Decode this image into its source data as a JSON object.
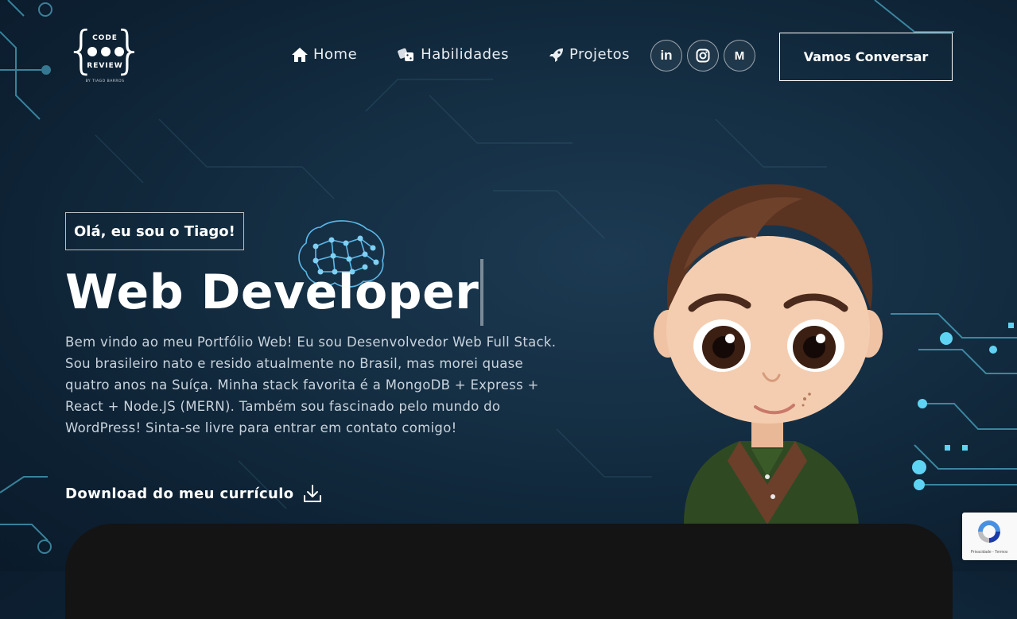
{
  "header": {
    "logo": {
      "top_text": "CODE",
      "bottom_text": "REVIEW",
      "byline": "BY TIAGO BARROS"
    },
    "nav": [
      {
        "label": "Home",
        "icon": "home-icon"
      },
      {
        "label": "Habilidades",
        "icon": "dice-icon"
      },
      {
        "label": "Projetos",
        "icon": "rocket-icon"
      }
    ],
    "social": [
      {
        "label": "in",
        "icon": "linkedin-icon"
      },
      {
        "label": "",
        "icon": "instagram-icon"
      },
      {
        "label": "M",
        "icon": "medium-icon"
      }
    ],
    "cta_label": "Vamos Conversar"
  },
  "hero": {
    "greeting": "Olá, eu sou o Tiago!",
    "title": "Web Developer",
    "description": "Bem vindo ao meu Portfólio Web! Eu sou Desenvolvedor Web Full Stack. Sou brasileiro nato e resido atualmente no Brasil, mas morei quase quatro anos na Suíça. Minha stack favorita é a MongoDB + Express + React + Node.JS (MERN). Também sou fascinado pelo mundo do WordPress! Sinta-se livre para entrar em contato comigo!",
    "download_label": "Download do meu currículo"
  },
  "recaptcha": {
    "text": "Privacidade - Termos"
  },
  "colors": {
    "background": "#132c40",
    "circuit_accent": "#5fd3f3",
    "panel": "#141414",
    "text": "#ffffff"
  }
}
